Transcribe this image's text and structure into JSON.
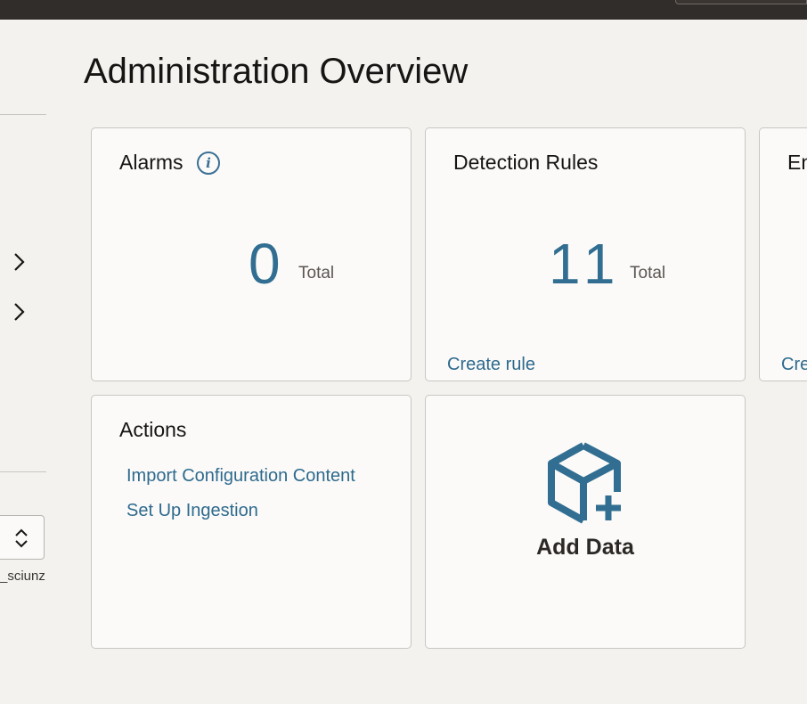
{
  "page": {
    "title": "Administration Overview"
  },
  "sidebar": {
    "user_label": "_sciunz"
  },
  "cards": {
    "alarms": {
      "title": "Alarms",
      "value": "0",
      "unit": "Total"
    },
    "detection_rules": {
      "title": "Detection Rules",
      "value": "11",
      "unit": "Total",
      "link": "Create rule"
    },
    "partial": {
      "title": "En",
      "link": "Cre"
    },
    "actions": {
      "title": "Actions",
      "links": [
        "Import Configuration Content",
        "Set Up Ingestion"
      ]
    },
    "add_data": {
      "label": "Add Data"
    }
  },
  "colors": {
    "accent": "#316e91",
    "link": "#2e6a8e",
    "topbar": "#312d2a",
    "background": "#f3f2ef",
    "card_background": "#fbfaf8"
  },
  "icons": {
    "info": "info-icon",
    "chevron": "chevron-right-icon",
    "add_data": "cube-plus-icon",
    "select": "up-down-chevron-icon"
  }
}
